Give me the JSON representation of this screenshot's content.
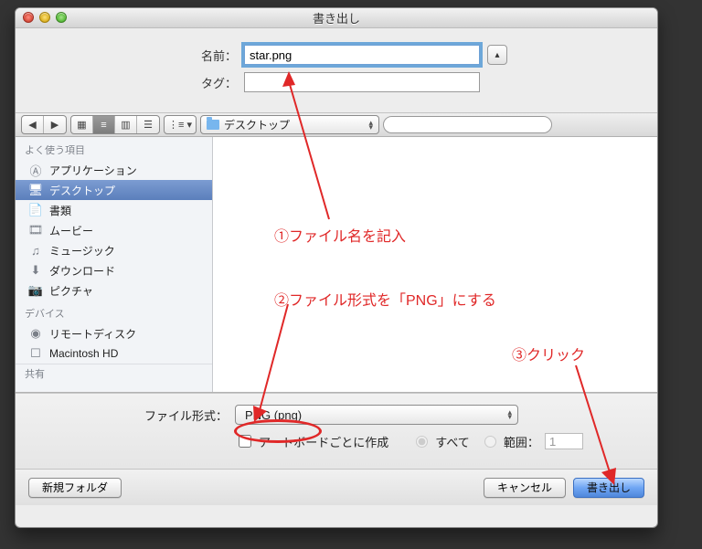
{
  "window": {
    "title": "書き出し"
  },
  "form": {
    "name_label": "名前：",
    "name_value": "star.png",
    "tag_label": "タグ："
  },
  "toolbar": {
    "back": "◀",
    "fwd": "▶",
    "location_label": "デスクトップ",
    "search_placeholder": ""
  },
  "sidebar": {
    "fav_header": "よく使う項目",
    "items": [
      {
        "icon": "A",
        "label": "アプリケーション"
      },
      {
        "icon": "⌾",
        "label": "デスクトップ"
      },
      {
        "icon": "📄",
        "label": "書類"
      },
      {
        "icon": "▦",
        "label": "ムービー"
      },
      {
        "icon": "♫",
        "label": "ミュージック"
      },
      {
        "icon": "⬇",
        "label": "ダウンロード"
      },
      {
        "icon": "📷",
        "label": "ピクチャ"
      }
    ],
    "dev_header": "デバイス",
    "dev_items": [
      {
        "icon": "◉",
        "label": "リモートディスク"
      },
      {
        "icon": "☐",
        "label": "Macintosh HD"
      }
    ],
    "shared_header": "共有"
  },
  "format": {
    "label": "ファイル形式：",
    "value": "PNG (png)",
    "per_artboard": "アートボードごとに作成",
    "all": "すべて",
    "range": "範囲：",
    "range_value": "1"
  },
  "footer": {
    "new_folder": "新規フォルダ",
    "cancel": "キャンセル",
    "export": "書き出し"
  },
  "annotations": {
    "a1": "①ファイル名を記入",
    "a2": "②ファイル形式を「PNG」にする",
    "a3": "③クリック"
  },
  "chart_data": null
}
